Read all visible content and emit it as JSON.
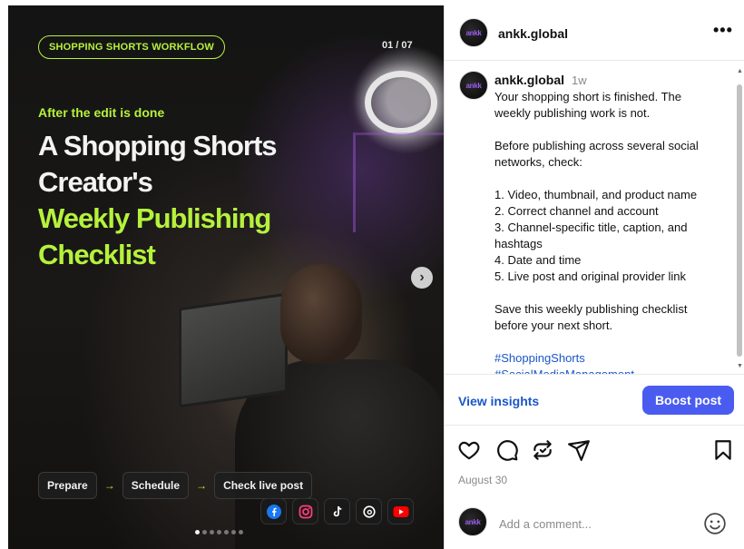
{
  "media": {
    "tag_label": "SHOPPING SHORTS WORKFLOW",
    "counter": "01 / 07",
    "eyebrow": "After the edit is done",
    "headline": {
      "line1": "A Shopping Shorts",
      "line2": "Creator's",
      "line3": "Weekly Publishing",
      "line4": "Checklist"
    },
    "accent_color": "#b5f23c",
    "steps": [
      "Prepare",
      "Schedule",
      "Check live post"
    ],
    "step_arrow": "→",
    "social_icons": [
      "facebook-icon",
      "instagram-icon",
      "tiktok-icon",
      "threads-icon",
      "youtube-icon"
    ],
    "carousel": {
      "total": 7,
      "active_index": 0
    }
  },
  "header": {
    "username": "ankk.global",
    "avatar_text": "ankk",
    "more_label": "•••"
  },
  "caption": {
    "username": "ankk.global",
    "time": "1w",
    "lines": [
      "Your shopping short is finished. The",
      "weekly publishing work is not.",
      "",
      "Before publishing across several social",
      "networks, check:",
      "",
      "1. Video, thumbnail, and product name",
      "2. Correct channel and account",
      "3. Channel-specific title, caption, and",
      "hashtags",
      "4. Date and time",
      "5. Live post and original provider link",
      "",
      "Save this weekly publishing checklist",
      "before your next short.",
      ""
    ],
    "hashtags": [
      "#ShoppingShorts",
      "#SocialMediaManagement"
    ]
  },
  "insights": {
    "view_insights_label": "View insights",
    "boost_label": "Boost post",
    "boost_color": "#4a5cf0"
  },
  "actions": {
    "icons": [
      "heart-icon",
      "comment-icon",
      "repost-icon",
      "share-icon",
      "bookmark-icon"
    ],
    "date": "August 30"
  },
  "comment": {
    "placeholder": "Add a comment..."
  }
}
